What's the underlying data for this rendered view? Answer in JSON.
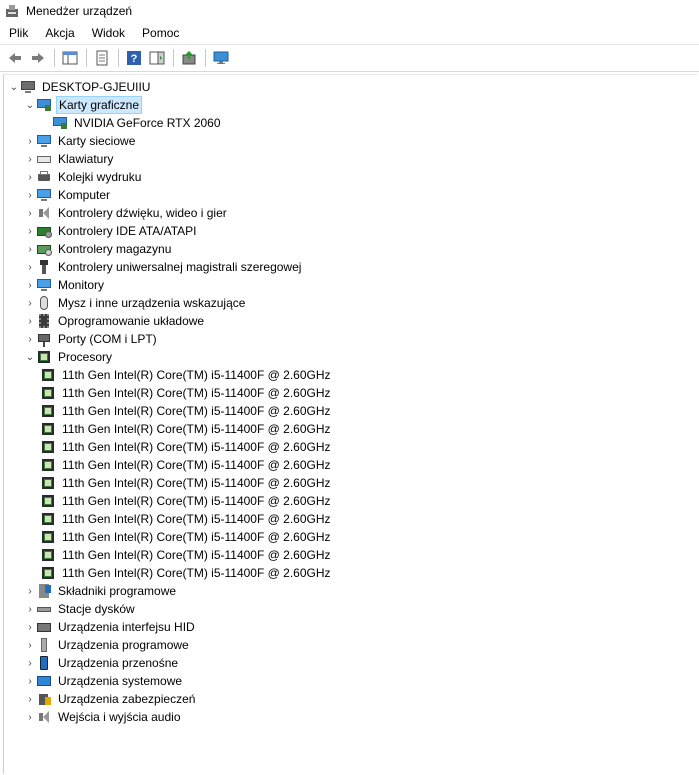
{
  "window": {
    "title": "Menedżer urządzeń"
  },
  "menu": [
    "Plik",
    "Akcja",
    "Widok",
    "Pomoc"
  ],
  "tree": {
    "root": "DESKTOP-GJEUIIU",
    "display_adapters": {
      "label": "Karty graficzne",
      "child": "NVIDIA GeForce RTX 2060"
    },
    "categories_a": [
      "Karty sieciowe",
      "Klawiatury",
      "Kolejki wydruku",
      "Komputer",
      "Kontrolery dźwięku, wideo i gier",
      "Kontrolery IDE ATA/ATAPI",
      "Kontrolery magazynu",
      "Kontrolery uniwersalnej magistrali szeregowej",
      "Monitory",
      "Mysz i inne urządzenia wskazujące",
      "Oprogramowanie układowe",
      "Porty (COM i LPT)"
    ],
    "processors": {
      "label": "Procesory",
      "items": [
        "11th Gen Intel(R) Core(TM) i5-11400F @ 2.60GHz",
        "11th Gen Intel(R) Core(TM) i5-11400F @ 2.60GHz",
        "11th Gen Intel(R) Core(TM) i5-11400F @ 2.60GHz",
        "11th Gen Intel(R) Core(TM) i5-11400F @ 2.60GHz",
        "11th Gen Intel(R) Core(TM) i5-11400F @ 2.60GHz",
        "11th Gen Intel(R) Core(TM) i5-11400F @ 2.60GHz",
        "11th Gen Intel(R) Core(TM) i5-11400F @ 2.60GHz",
        "11th Gen Intel(R) Core(TM) i5-11400F @ 2.60GHz",
        "11th Gen Intel(R) Core(TM) i5-11400F @ 2.60GHz",
        "11th Gen Intel(R) Core(TM) i5-11400F @ 2.60GHz",
        "11th Gen Intel(R) Core(TM) i5-11400F @ 2.60GHz",
        "11th Gen Intel(R) Core(TM) i5-11400F @ 2.60GHz"
      ]
    },
    "categories_b": [
      "Składniki programowe",
      "Stacje dysków",
      "Urządzenia interfejsu HID",
      "Urządzenia programowe",
      "Urządzenia przenośne",
      "Urządzenia systemowe",
      "Urządzenia zabezpieczeń",
      "Wejścia i wyjścia audio"
    ]
  },
  "colors": {
    "selection_bg": "#cce8ff",
    "selection_border": "#99d1ff"
  }
}
